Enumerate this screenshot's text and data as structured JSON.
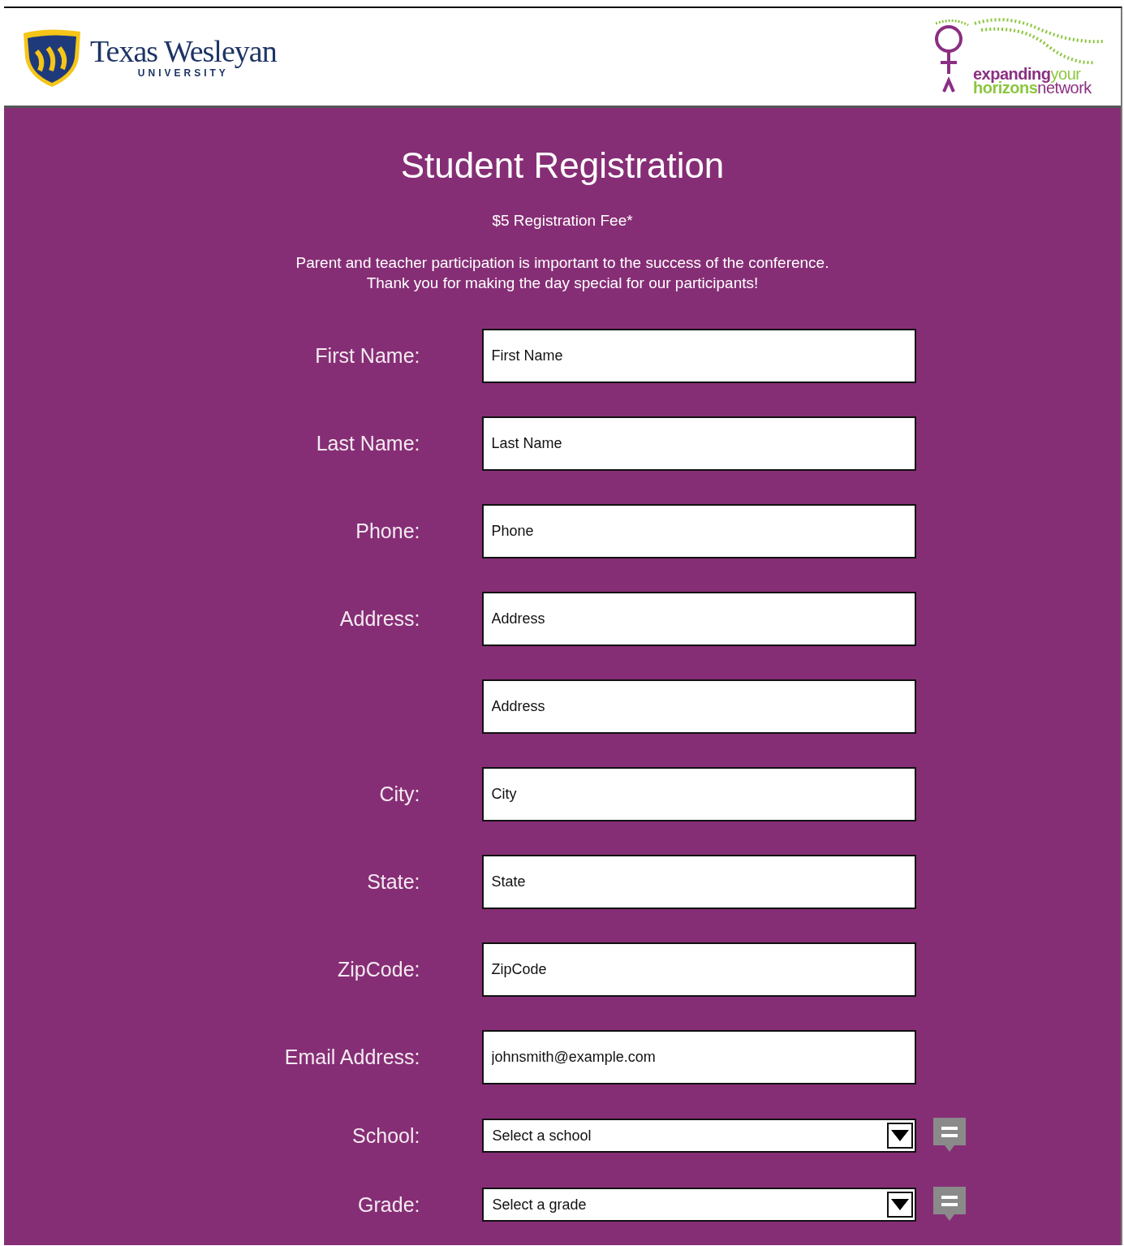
{
  "header": {
    "left_logo": {
      "name": "Texas Wesleyan",
      "subtitle": "UNIVERSITY"
    },
    "right_logo": {
      "lines": [
        [
          {
            "text": "expanding",
            "bold": true,
            "color": "#8b2f83"
          },
          {
            "text": "your",
            "bold": false,
            "color": "#8cc63f"
          }
        ],
        [
          {
            "text": "horizons",
            "bold": true,
            "color": "#8cc63f"
          },
          {
            "text": "network",
            "bold": false,
            "color": "#8b2f83"
          }
        ]
      ]
    }
  },
  "title": "Student Registration",
  "fee": "$5 Registration Fee*",
  "intro": [
    "Parent and teacher participation is important to the success of the conference.",
    "Thank you  for making the day special for our participants!"
  ],
  "fields": [
    {
      "kind": "text",
      "label": "First Name:",
      "placeholder": "First Name"
    },
    {
      "kind": "text",
      "label": "Last Name:",
      "placeholder": "Last Name"
    },
    {
      "kind": "text",
      "label": "Phone:",
      "placeholder": "Phone"
    },
    {
      "kind": "text",
      "label": "Address:",
      "placeholder": "Address"
    },
    {
      "kind": "text",
      "placeholder": "Address"
    },
    {
      "kind": "text",
      "label": "City:",
      "placeholder": "City"
    },
    {
      "kind": "text",
      "label": "State:",
      "placeholder": "State"
    },
    {
      "kind": "text",
      "label": "ZipCode:",
      "placeholder": "ZipCode"
    },
    {
      "kind": "text",
      "label": "Email Address:",
      "placeholder": "johnsmith@example.com"
    },
    {
      "kind": "select",
      "label": "School:",
      "value": "Select a school"
    },
    {
      "kind": "select",
      "label": "Grade:",
      "value": "Select a grade"
    }
  ]
}
